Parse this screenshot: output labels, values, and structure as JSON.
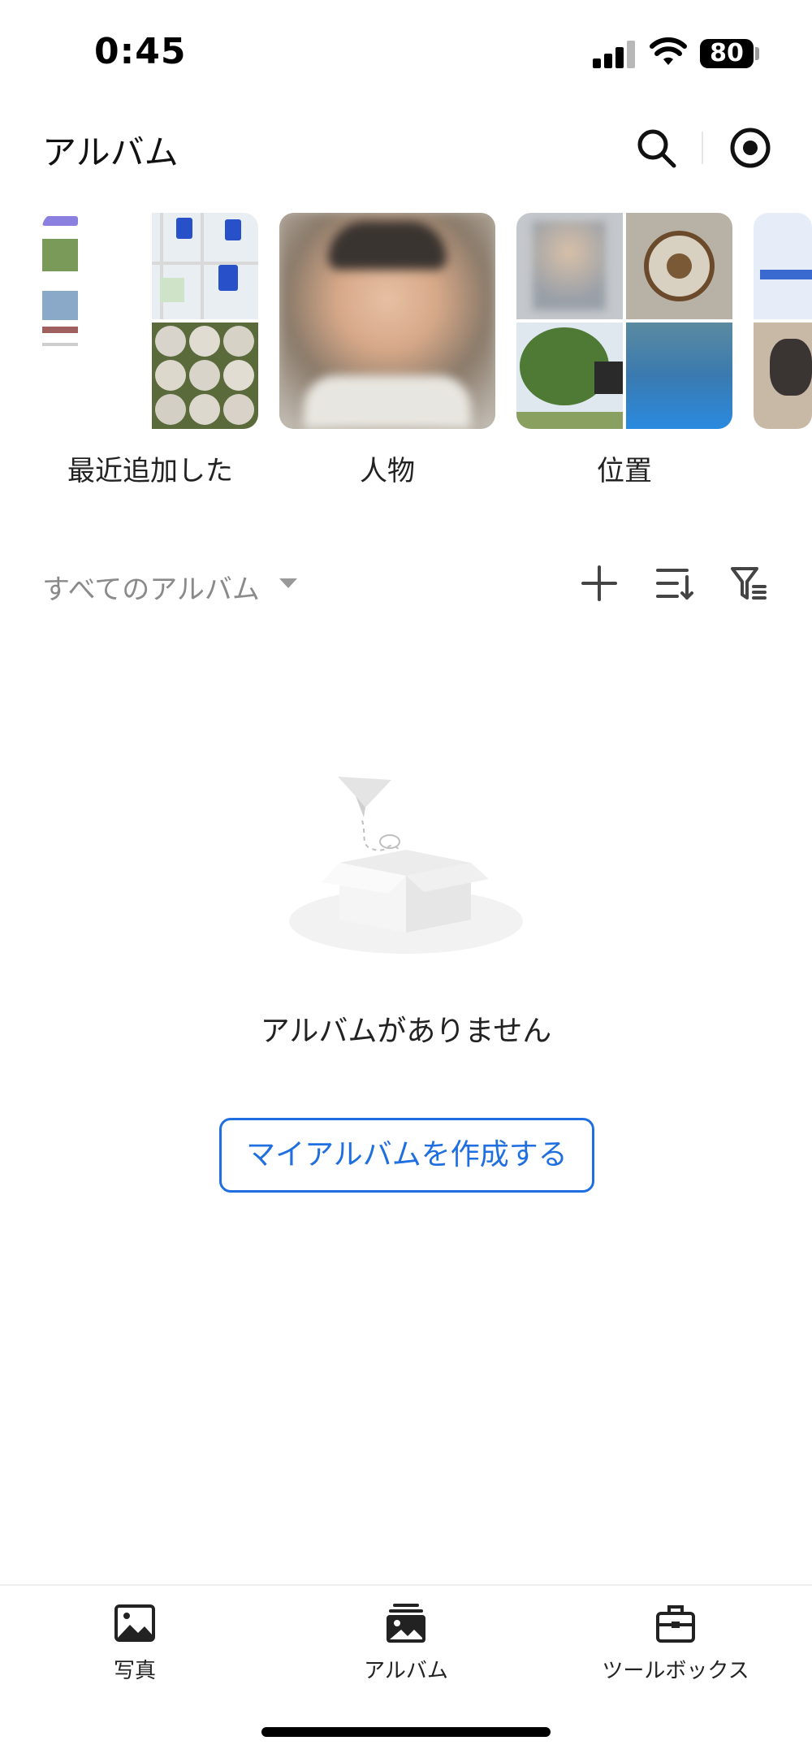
{
  "status_bar": {
    "time": "0:45",
    "battery": "80"
  },
  "header": {
    "title": "アルバム"
  },
  "featured_albums": [
    {
      "label": "最近追加した"
    },
    {
      "label": "人物"
    },
    {
      "label": "位置"
    }
  ],
  "section": {
    "title": "すべてのアルバム"
  },
  "empty_state": {
    "message": "アルバムがありません",
    "button_label": "マイアルバムを作成する"
  },
  "tab_bar": [
    {
      "label": "写真",
      "icon": "photo-icon"
    },
    {
      "label": "アルバム",
      "icon": "albums-icon"
    },
    {
      "label": "ツールボックス",
      "icon": "toolbox-icon"
    }
  ],
  "colors": {
    "accent": "#1f6fe0",
    "muted_text": "#8a8a8a"
  }
}
